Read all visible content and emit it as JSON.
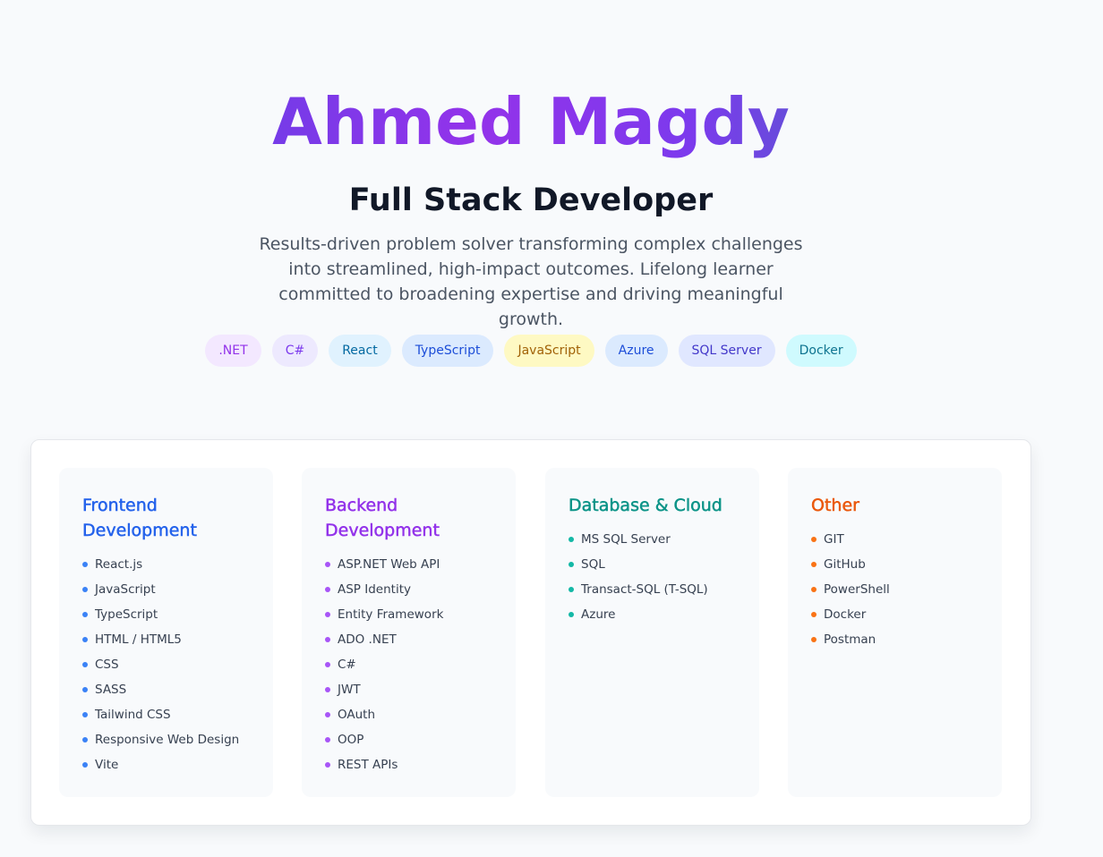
{
  "hero": {
    "name": "Ahmed Magdy",
    "role": "Full Stack Developer",
    "bio": "Results-driven problem solver transforming complex challenges into streamlined, high-impact outcomes. Lifelong learner committed to broadening expertise and driving meaningful growth."
  },
  "tags": [
    {
      "label": ".NET",
      "bg": "#f3e8ff",
      "fg": "#9333ea"
    },
    {
      "label": "C#",
      "bg": "#ede9fe",
      "fg": "#7c3aed"
    },
    {
      "label": "React",
      "bg": "#e0f2fe",
      "fg": "#0369a1"
    },
    {
      "label": "TypeScript",
      "bg": "#dbeafe",
      "fg": "#1d4ed8"
    },
    {
      "label": "JavaScript",
      "bg": "#fef9c3",
      "fg": "#a16207"
    },
    {
      "label": "Azure",
      "bg": "#dbeafe",
      "fg": "#1d4ed8"
    },
    {
      "label": "SQL Server",
      "bg": "#e0e7ff",
      "fg": "#4338ca"
    },
    {
      "label": "Docker",
      "bg": "#cffafe",
      "fg": "#0e7490"
    }
  ],
  "skills": [
    {
      "title": "Frontend Development",
      "color": "#2563eb",
      "dot": "#3b82f6",
      "items": [
        "React.js",
        "JavaScript",
        "TypeScript",
        "HTML / HTML5",
        "CSS",
        "SASS",
        "Tailwind CSS",
        "Responsive Web Design",
        "Vite"
      ]
    },
    {
      "title": "Backend Development",
      "color": "#9333ea",
      "dot": "#a855f7",
      "items": [
        "ASP.NET Web API",
        "ASP Identity",
        "Entity Framework",
        "ADO .NET",
        "C#",
        "JWT",
        "OAuth",
        "OOP",
        "REST APIs"
      ]
    },
    {
      "title": "Database & Cloud",
      "color": "#0d9488",
      "dot": "#14b8a6",
      "items": [
        "MS SQL Server",
        "SQL",
        "Transact-SQL (T-SQL)",
        "Azure"
      ]
    },
    {
      "title": "Other",
      "color": "#ea580c",
      "dot": "#f97316",
      "items": [
        "GIT",
        "GitHub",
        "PowerShell",
        "Docker",
        "Postman"
      ]
    }
  ]
}
